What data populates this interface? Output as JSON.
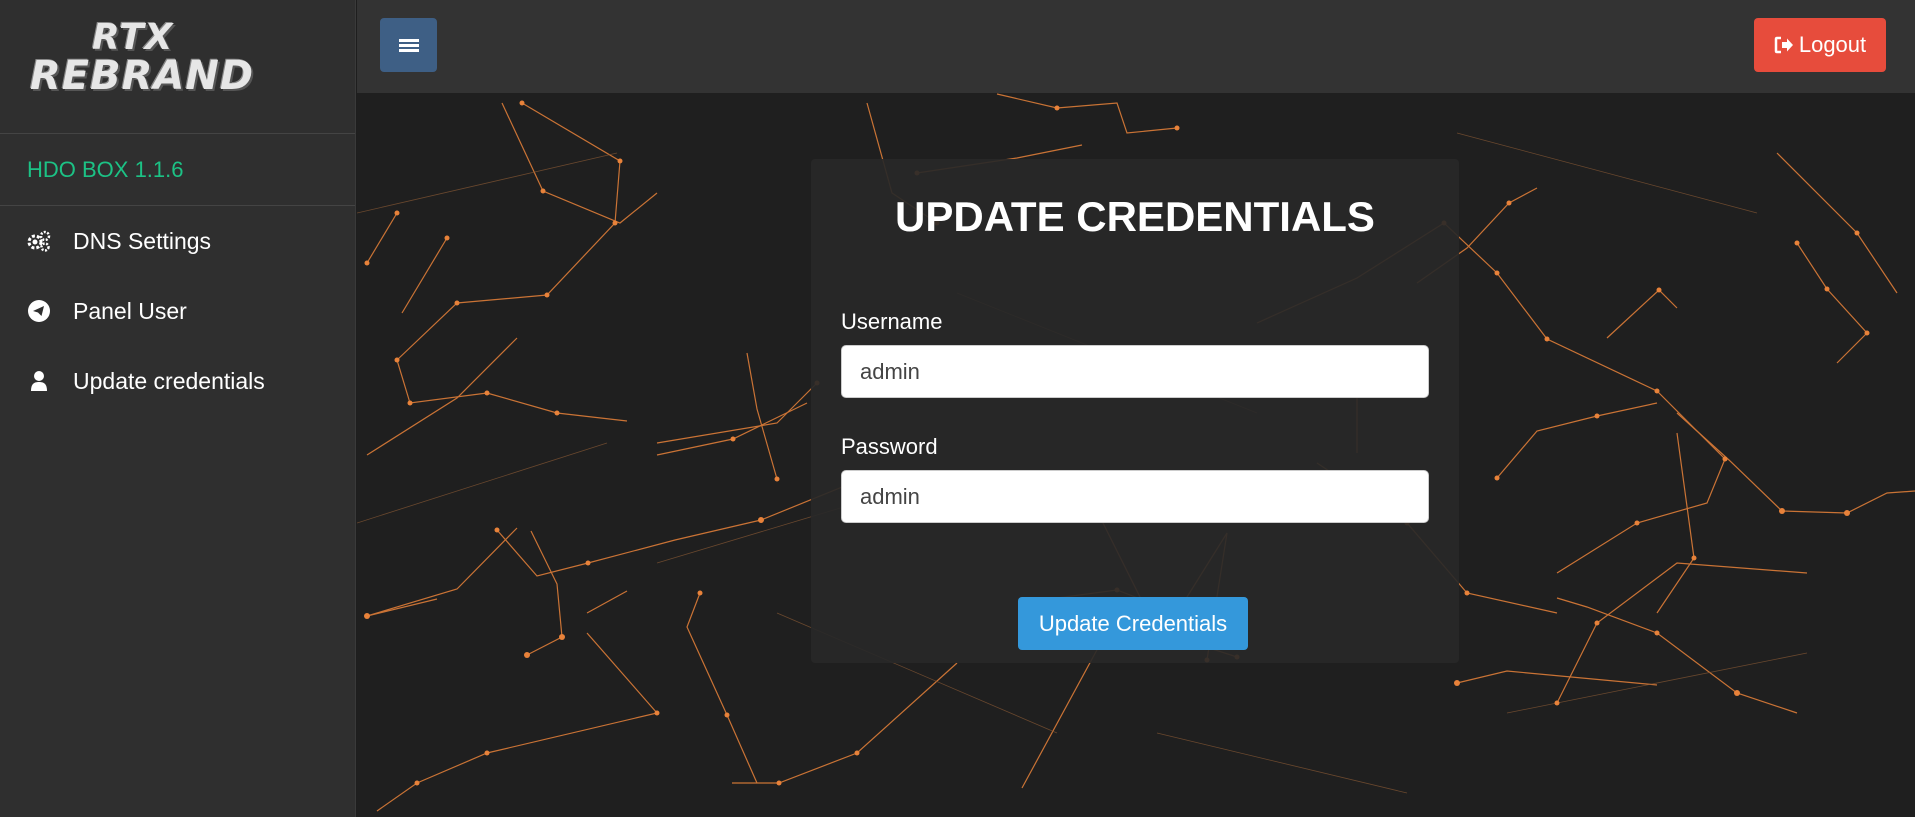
{
  "logo": {
    "line1": "RTX",
    "line2": "REBRAND"
  },
  "sidebar": {
    "version": "HDO BOX 1.1.6",
    "items": [
      {
        "label": "DNS Settings",
        "icon": "gears-icon"
      },
      {
        "label": "Panel User",
        "icon": "telegram-icon"
      },
      {
        "label": "Update credentials",
        "icon": "user-icon"
      }
    ]
  },
  "topbar": {
    "menu_icon": "hamburger-icon",
    "logout_label": "Logout",
    "logout_icon": "sign-out-icon"
  },
  "form": {
    "title": "UPDATE CREDENTIALS",
    "username_label": "Username",
    "username_value": "admin",
    "password_label": "Password",
    "password_value": "admin",
    "submit_label": "Update Credentials"
  },
  "colors": {
    "sidebar_bg": "#2f2f2f",
    "topbar_bg": "#333333",
    "version_green": "#1cc285",
    "menu_button": "#3e5f85",
    "logout_red": "#e74c3c",
    "submit_blue": "#3498db",
    "network_orange": "#e8823a"
  }
}
